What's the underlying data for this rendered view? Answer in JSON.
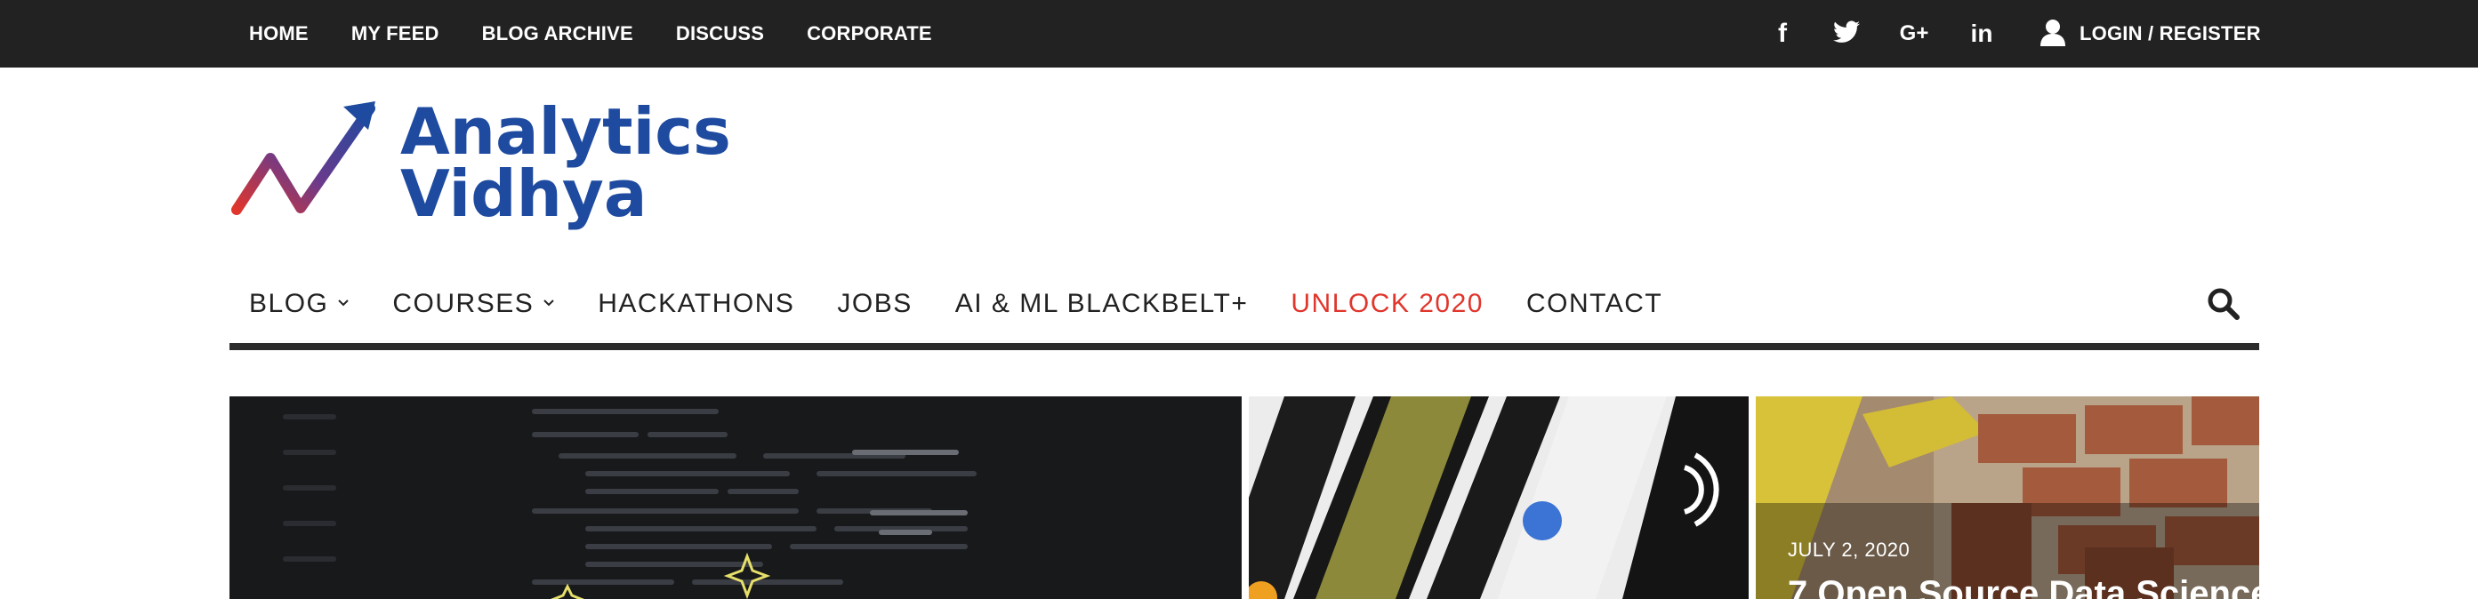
{
  "topbar": {
    "links": [
      "HOME",
      "MY FEED",
      "BLOG ARCHIVE",
      "DISCUSS",
      "CORPORATE"
    ],
    "social": [
      {
        "icon": "facebook-icon",
        "glyph": "f"
      },
      {
        "icon": "twitter-icon",
        "glyph": ""
      },
      {
        "icon": "google-plus-icon",
        "glyph": "G+"
      },
      {
        "icon": "linkedin-icon",
        "glyph": "in"
      }
    ],
    "login_label": "LOGIN / REGISTER"
  },
  "logo": {
    "line1": "Analytics",
    "line2": "Vidhya",
    "colors": {
      "text": "#1e4aa0",
      "mark_start": "#e0362c",
      "mark_end": "#1e4aa0"
    }
  },
  "main_nav": {
    "items": [
      {
        "label": "BLOG",
        "dropdown": true
      },
      {
        "label": "COURSES",
        "dropdown": true
      },
      {
        "label": "HACKATHONS",
        "dropdown": false
      },
      {
        "label": "JOBS",
        "dropdown": false
      },
      {
        "label": "AI & ML BLACKBELT+",
        "dropdown": false
      },
      {
        "label": "UNLOCK 2020",
        "dropdown": false,
        "highlight_color": "#e0362c"
      },
      {
        "label": "CONTACT",
        "dropdown": false
      }
    ],
    "search_icon": "search-icon"
  },
  "featured": {
    "tiles": [
      {
        "kind": "image",
        "subject": "code-screen"
      },
      {
        "kind": "image",
        "subject": "card-reader"
      },
      {
        "kind": "article",
        "subject": "bricks-ruler",
        "date": "JULY 2, 2020",
        "title": "7 Open Source Data Science"
      }
    ]
  },
  "colors": {
    "topbar_bg": "#222222",
    "accent": "#e0362c",
    "brand": "#1e4aa0"
  }
}
